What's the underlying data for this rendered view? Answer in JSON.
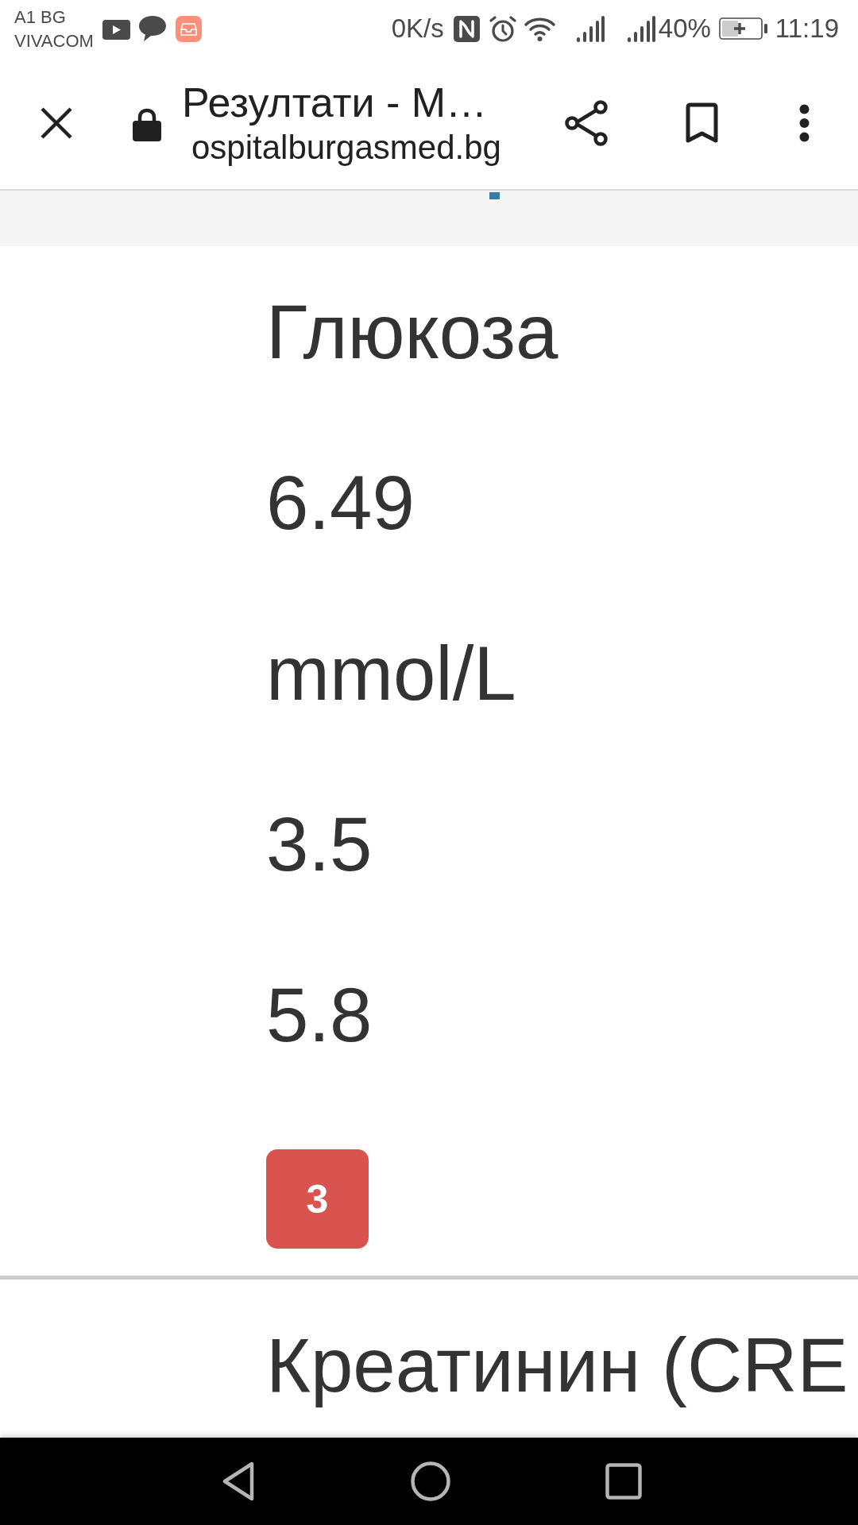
{
  "status_bar": {
    "carrier_lines": [
      "A1 BG",
      "VIVACOM"
    ],
    "net_speed": "0K/s",
    "battery_percent": "40%",
    "time": "11:19"
  },
  "browser_toolbar": {
    "title": "Резултати - М…",
    "url": "ospitalburgasmed.bg"
  },
  "table": {
    "rows": [
      {
        "cells": [
          {
            "kind": "text",
            "text": "Глюкоза"
          },
          {
            "kind": "text",
            "text": "6.49"
          },
          {
            "kind": "text",
            "text": "mmol/L"
          },
          {
            "kind": "text",
            "text": "3.5"
          },
          {
            "kind": "text",
            "text": "5.8"
          },
          {
            "kind": "badge",
            "text": "3"
          }
        ]
      },
      {
        "cells": [
          {
            "kind": "text",
            "text": "Креатинин (CRE"
          }
        ]
      }
    ]
  }
}
